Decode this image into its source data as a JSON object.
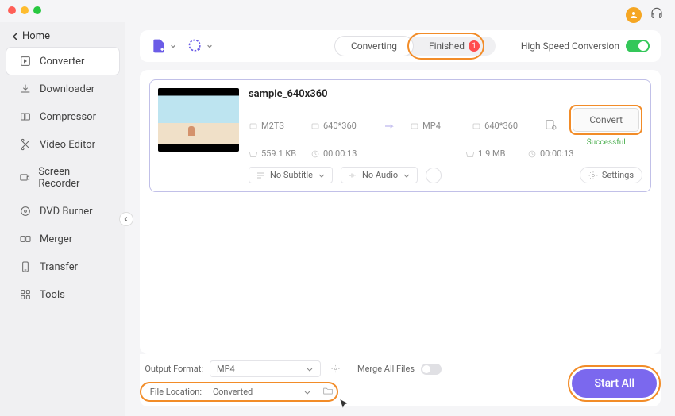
{
  "window": {
    "home": "Home"
  },
  "sidebar": {
    "items": [
      {
        "label": "Converter"
      },
      {
        "label": "Downloader"
      },
      {
        "label": "Compressor"
      },
      {
        "label": "Video Editor"
      },
      {
        "label": "Screen Recorder"
      },
      {
        "label": "DVD Burner"
      },
      {
        "label": "Merger"
      },
      {
        "label": "Transfer"
      },
      {
        "label": "Tools"
      }
    ]
  },
  "toolbar": {
    "tabs": {
      "converting": "Converting",
      "finished": "Finished",
      "finished_badge": "1"
    },
    "high_speed_label": "High Speed Conversion"
  },
  "item": {
    "title": "sample_640x360",
    "src": {
      "format": "M2TS",
      "res": "640*360",
      "size": "559.1 KB",
      "dur": "00:00:13"
    },
    "dst": {
      "format": "MP4",
      "res": "640*360",
      "size": "1.9 MB",
      "dur": "00:00:13"
    },
    "convert_label": "Convert",
    "status": "Successful",
    "subtitle": "No Subtitle",
    "audio": "No Audio",
    "settings_label": "Settings"
  },
  "footer": {
    "output_format_label": "Output Format:",
    "output_format_value": "MP4",
    "file_location_label": "File Location:",
    "file_location_value": "Converted",
    "merge_label": "Merge All Files",
    "start_all": "Start All"
  }
}
